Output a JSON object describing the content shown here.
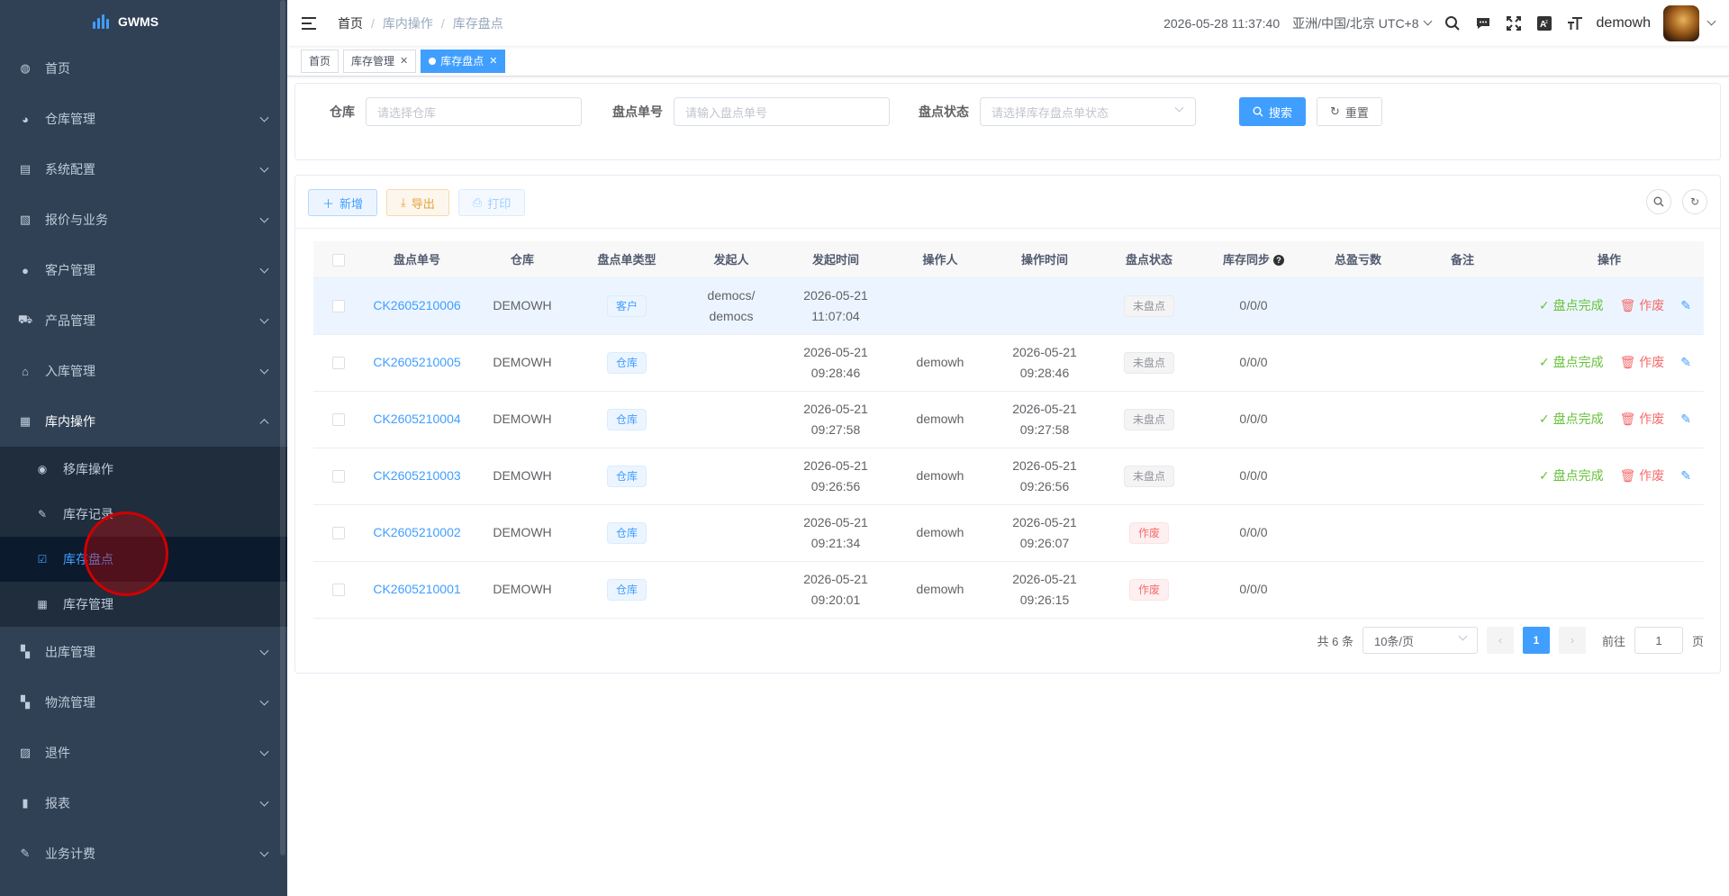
{
  "app": {
    "name": "GWMS"
  },
  "sidebar": {
    "items": [
      {
        "label": "首页",
        "icon": "dashboard-icon"
      },
      {
        "label": "仓库管理",
        "icon": "warehouse-icon"
      },
      {
        "label": "系统配置",
        "icon": "system-config-icon"
      },
      {
        "label": "报价与业务",
        "icon": "quote-icon"
      },
      {
        "label": "客户管理",
        "icon": "user-icon"
      },
      {
        "label": "产品管理",
        "icon": "cart-icon"
      },
      {
        "label": "入库管理",
        "icon": "home-icon"
      },
      {
        "label": "库内操作",
        "icon": "table-icon"
      }
    ],
    "sub_items": [
      {
        "label": "移库操作",
        "icon": "eye-icon"
      },
      {
        "label": "库存记录",
        "icon": "edit-icon"
      },
      {
        "label": "库存盘点",
        "icon": "checkbox-icon"
      },
      {
        "label": "库存管理",
        "icon": "table-icon"
      }
    ],
    "items_after": [
      {
        "label": "出库管理",
        "icon": "grid-icon"
      },
      {
        "label": "物流管理",
        "icon": "grid-icon"
      },
      {
        "label": "退件",
        "icon": "return-icon"
      },
      {
        "label": "报表",
        "icon": "chart-icon"
      },
      {
        "label": "业务计费",
        "icon": "billing-icon"
      }
    ]
  },
  "navbar": {
    "breadcrumb": [
      "首页",
      "库内操作",
      "库存盘点"
    ],
    "datetime": "2026-05-28 11:37:40",
    "timezone": "亚洲/中国/北京 UTC+8",
    "username": "demowh"
  },
  "tags": [
    "首页",
    "库存管理",
    "库存盘点"
  ],
  "search": {
    "warehouse_label": "仓库",
    "warehouse_placeholder": "请选择仓库",
    "order_label": "盘点单号",
    "order_placeholder": "请输入盘点单号",
    "status_label": "盘点状态",
    "status_placeholder": "请选择库存盘点单状态",
    "search_button": "搜索",
    "reset_button": "重置"
  },
  "toolbar": {
    "add": "新增",
    "export": "导出",
    "print": "打印"
  },
  "table": {
    "headers": [
      "盘点单号",
      "仓库",
      "盘点单类型",
      "发起人",
      "发起时间",
      "操作人",
      "操作时间",
      "盘点状态",
      "库存同步",
      "总盈亏数",
      "备注",
      "操作"
    ],
    "rows": [
      {
        "no": "CK2605210006",
        "warehouse": "DEMOWH",
        "type": "客户",
        "initiator1": "democs/",
        "initiator2": "democs",
        "start_date": "2026-05-21",
        "start_time": "11:07:04",
        "operator": "",
        "op_date": "",
        "op_time": "",
        "status": "未盘点",
        "status_color": "gray",
        "sync": "0/0/0",
        "total": "",
        "remark": "",
        "has_ops": true
      },
      {
        "no": "CK2605210005",
        "warehouse": "DEMOWH",
        "type": "仓库",
        "initiator1": "",
        "initiator2": "",
        "start_date": "2026-05-21",
        "start_time": "09:28:46",
        "operator": "demowh",
        "op_date": "2026-05-21",
        "op_time": "09:28:46",
        "status": "未盘点",
        "status_color": "gray",
        "sync": "0/0/0",
        "total": "",
        "remark": "",
        "has_ops": true
      },
      {
        "no": "CK2605210004",
        "warehouse": "DEMOWH",
        "type": "仓库",
        "initiator1": "",
        "initiator2": "",
        "start_date": "2026-05-21",
        "start_time": "09:27:58",
        "operator": "demowh",
        "op_date": "2026-05-21",
        "op_time": "09:27:58",
        "status": "未盘点",
        "status_color": "gray",
        "sync": "0/0/0",
        "total": "",
        "remark": "",
        "has_ops": true
      },
      {
        "no": "CK2605210003",
        "warehouse": "DEMOWH",
        "type": "仓库",
        "initiator1": "",
        "initiator2": "",
        "start_date": "2026-05-21",
        "start_time": "09:26:56",
        "operator": "demowh",
        "op_date": "2026-05-21",
        "op_time": "09:26:56",
        "status": "未盘点",
        "status_color": "gray",
        "sync": "0/0/0",
        "total": "",
        "remark": "",
        "has_ops": true
      },
      {
        "no": "CK2605210002",
        "warehouse": "DEMOWH",
        "type": "仓库",
        "initiator1": "",
        "initiator2": "",
        "start_date": "2026-05-21",
        "start_time": "09:21:34",
        "operator": "demowh",
        "op_date": "2026-05-21",
        "op_time": "09:26:07",
        "status": "作废",
        "status_color": "red",
        "sync": "0/0/0",
        "total": "",
        "remark": "",
        "has_ops": false
      },
      {
        "no": "CK2605210001",
        "warehouse": "DEMOWH",
        "type": "仓库",
        "initiator1": "",
        "initiator2": "",
        "start_date": "2026-05-21",
        "start_time": "09:20:01",
        "operator": "demowh",
        "op_date": "2026-05-21",
        "op_time": "09:26:15",
        "status": "作废",
        "status_color": "red",
        "sync": "0/0/0",
        "total": "",
        "remark": "",
        "has_ops": false
      }
    ],
    "ops": {
      "complete": "盘点完成",
      "void": "作废"
    }
  },
  "pagination": {
    "total": "共 6 条",
    "page_size": "10条/页",
    "current": "1",
    "goto_label": "前往",
    "goto_value": "1",
    "page_suffix": "页"
  },
  "colors": {
    "sidebar_bg": "#304156",
    "accent": "#409eff",
    "success": "#67c23a",
    "danger": "#f56c6c",
    "warning": "#e6a23c"
  }
}
